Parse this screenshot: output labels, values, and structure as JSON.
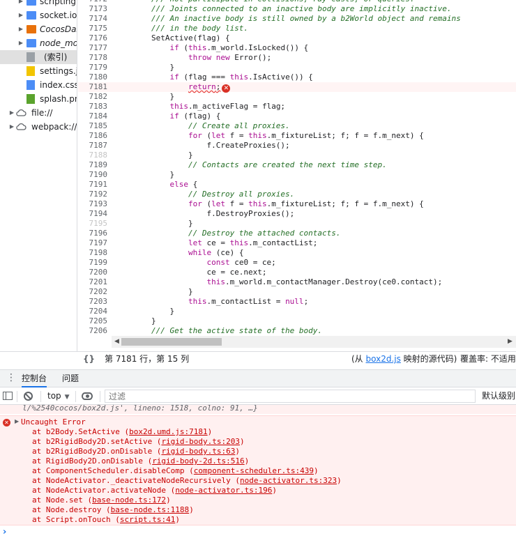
{
  "navigator": {
    "items": [
      {
        "label": "scripting",
        "icon": "folder-blue",
        "italic": false,
        "has_arrow": true
      },
      {
        "label": "socket.io",
        "icon": "folder-blue",
        "italic": false,
        "has_arrow": true
      },
      {
        "label": "CocosDash",
        "icon": "folder-orange",
        "italic": true,
        "has_arrow": true
      },
      {
        "label": "node_mod",
        "icon": "folder-blue",
        "italic": true,
        "has_arrow": true
      },
      {
        "label": "(索引)",
        "icon": "file-gray",
        "italic": false,
        "has_arrow": false
      },
      {
        "label": "settings.js",
        "icon": "file-yellow",
        "italic": false,
        "has_arrow": false
      },
      {
        "label": "index.css",
        "icon": "file-blue",
        "italic": false,
        "has_arrow": false
      },
      {
        "label": "splash.png",
        "icon": "file-green",
        "italic": false,
        "has_arrow": false
      },
      {
        "label": "file://",
        "icon": "cloud",
        "italic": false,
        "has_arrow": true
      },
      {
        "label": "webpack://",
        "icon": "cloud",
        "italic": false,
        "has_arrow": true
      }
    ]
  },
  "editor": {
    "lines": [
      {
        "n": "7172",
        "t": "        /// not participate in collisions, ray-casts, or queries.",
        "c": "cm"
      },
      {
        "n": "7173",
        "t": "        /// Joints connected to an inactive body are implicitly inactive.",
        "c": "cm"
      },
      {
        "n": "7174",
        "t": "        /// An inactive body is still owned by a b2World object and remains",
        "c": "cm"
      },
      {
        "n": "7175",
        "t": "        /// in the body list.",
        "c": "cm"
      },
      {
        "n": "7176",
        "t": "        SetActive(flag) {",
        "c": ""
      },
      {
        "n": "7177",
        "t": "            if (this.m_world.IsLocked()) {",
        "c": ""
      },
      {
        "n": "7178",
        "t": "                throw new Error();",
        "c": ""
      },
      {
        "n": "7179",
        "t": "            }",
        "c": ""
      },
      {
        "n": "7180",
        "t": "            if (flag === this.IsActive()) {",
        "c": ""
      },
      {
        "n": "7181",
        "t": "                return;",
        "c": "err"
      },
      {
        "n": "7182",
        "t": "            }",
        "c": ""
      },
      {
        "n": "7183",
        "t": "            this.m_activeFlag = flag;",
        "c": ""
      },
      {
        "n": "7184",
        "t": "            if (flag) {",
        "c": ""
      },
      {
        "n": "7185",
        "t": "                // Create all proxies.",
        "c": "cm"
      },
      {
        "n": "7186",
        "t": "                for (let f = this.m_fixtureList; f; f = f.m_next) {",
        "c": ""
      },
      {
        "n": "7187",
        "t": "                    f.CreateProxies();",
        "c": ""
      },
      {
        "n": "7188",
        "t": "                }",
        "c": "",
        "faded": true
      },
      {
        "n": "7189",
        "t": "                // Contacts are created the next time step.",
        "c": "cm"
      },
      {
        "n": "7190",
        "t": "            }",
        "c": ""
      },
      {
        "n": "7191",
        "t": "            else {",
        "c": ""
      },
      {
        "n": "7192",
        "t": "                // Destroy all proxies.",
        "c": "cm"
      },
      {
        "n": "7193",
        "t": "                for (let f = this.m_fixtureList; f; f = f.m_next) {",
        "c": ""
      },
      {
        "n": "7194",
        "t": "                    f.DestroyProxies();",
        "c": ""
      },
      {
        "n": "7195",
        "t": "                }",
        "c": "",
        "faded": true
      },
      {
        "n": "7196",
        "t": "                // Destroy the attached contacts.",
        "c": "cm"
      },
      {
        "n": "7197",
        "t": "                let ce = this.m_contactList;",
        "c": ""
      },
      {
        "n": "7198",
        "t": "                while (ce) {",
        "c": ""
      },
      {
        "n": "7199",
        "t": "                    const ce0 = ce;",
        "c": ""
      },
      {
        "n": "7200",
        "t": "                    ce = ce.next;",
        "c": ""
      },
      {
        "n": "7201",
        "t": "                    this.m_world.m_contactManager.Destroy(ce0.contact);",
        "c": ""
      },
      {
        "n": "7202",
        "t": "                }",
        "c": ""
      },
      {
        "n": "7203",
        "t": "                this.m_contactList = null;",
        "c": ""
      },
      {
        "n": "7204",
        "t": "            }",
        "c": ""
      },
      {
        "n": "7205",
        "t": "        }",
        "c": ""
      },
      {
        "n": "7206",
        "t": "        /// Get the active state of the body.",
        "c": "cm"
      },
      {
        "n": "7207",
        "t": "",
        "c": ""
      }
    ]
  },
  "status_bar": {
    "braces": "{}",
    "position": "第 7181 行，第 15 列",
    "source_prefix": "(从 ",
    "source_file": "box2d.js",
    "source_suffix": " 映射的源代码)",
    "coverage": "覆盖率: 不适用"
  },
  "drawer": {
    "tabs": [
      {
        "label": "控制台"
      },
      {
        "label": "问题"
      }
    ],
    "active_tab": "控制台"
  },
  "console_toolbar": {
    "context": "top",
    "filter_placeholder": "过滤",
    "level": "默认级别"
  },
  "console": {
    "previous_message": "l/%2540cocos/box2d.js', lineno: 1518, colno: 91, …}",
    "error_title": "Uncaught Error",
    "stack": [
      {
        "fn": "b2Body.SetActive",
        "loc": "box2d.umd.js:7181"
      },
      {
        "fn": "b2RigidBody2D.setActive",
        "loc": "rigid-body.ts:203"
      },
      {
        "fn": "b2RigidBody2D.onDisable",
        "loc": "rigid-body.ts:63"
      },
      {
        "fn": "RigidBody2D.onDisable",
        "loc": "rigid-body-2d.ts:516"
      },
      {
        "fn": "ComponentScheduler.disableComp",
        "loc": "component-scheduler.ts:439"
      },
      {
        "fn": "NodeActivator._deactivateNodeRecursively",
        "loc": "node-activator.ts:323"
      },
      {
        "fn": "NodeActivator.activateNode",
        "loc": "node-activator.ts:196"
      },
      {
        "fn": "Node.set",
        "loc": "base-node.ts:172"
      },
      {
        "fn": "Node.destroy",
        "loc": "base-node.ts:1188"
      },
      {
        "fn": "Script.onTouch",
        "loc": "script.ts:41"
      }
    ],
    "prompt": "›"
  }
}
